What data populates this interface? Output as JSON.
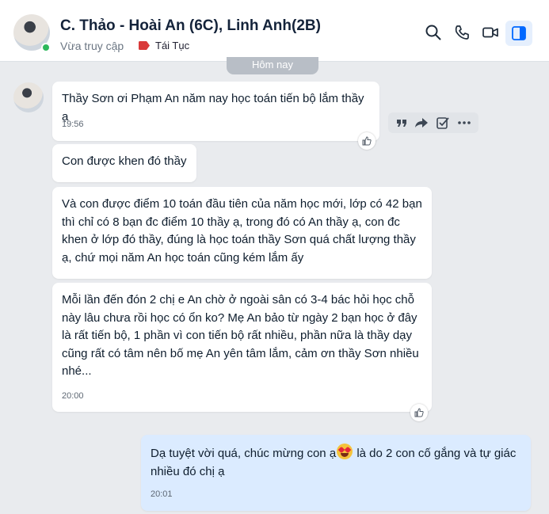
{
  "header": {
    "title": "C. Thảo - Hoài An (6C), Linh Anh(2B)",
    "presence": "Vừa truy cập",
    "tag_label": "Tái Tục",
    "tag_color": "#d93a3a",
    "icons": [
      "search-icon",
      "phone-icon",
      "video-call-icon",
      "sidebar-toggle-icon"
    ]
  },
  "date_divider": "Hôm nay",
  "messages": [
    {
      "text": "Thầy Sơn ơi Phạm An năm nay học toán tiến bộ lắm thầy ạ",
      "time": "19:56"
    },
    {
      "text": "Con được khen đó thầy"
    },
    {
      "text": "Và con được điểm 10 toán đầu tiên của năm học mới, lớp có 42 bạn thì chỉ có 8 bạn đc điểm 10 thầy ạ, trong đó có An thầy ạ, con đc khen ở lớp đó thầy, đúng là học toán thầy Sơn quá chất lượng thầy ạ, chứ mọi năm An học toán cũng kém lắm ấy"
    },
    {
      "text": "Mỗi lần đến đón 2 chị e An chờ ở ngoài sân có 3-4 bác hỏi học chỗ này lâu chưa rồi học có ổn ko? Mẹ An bảo từ ngày 2 bạn học ở đây là rất tiến bộ, 1 phần vì con tiến bộ rất nhiều, phần nữa là thầy dạy cũng rất có tâm nên bố mẹ An yên tâm lắm, cảm ơn thầy Sơn nhiều nhé...",
      "time": "20:00"
    }
  ],
  "reply": {
    "text_before": "Dạ tuyệt vời quá, chúc mừng con ạ",
    "emoji": "heart-eyes-emoji",
    "text_after": " là do 2 con cố gắng và tự giác nhiều đó chị ạ",
    "time": "20:01"
  },
  "colors": {
    "accent": "#0068ff",
    "my_bubble": "#dbebff",
    "background": "#e9ebee"
  }
}
